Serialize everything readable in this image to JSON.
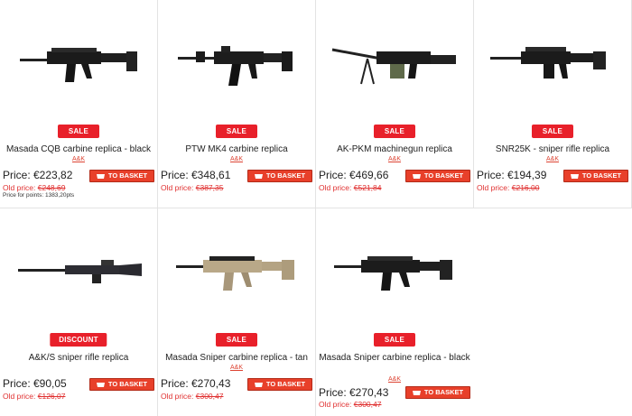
{
  "products": [
    {
      "name": "Masada CQB carbine replica - black",
      "brand": "A&K",
      "badge": "SALE",
      "price": "Price: €223,82",
      "old_label": "Old price: ",
      "old_value": "€248,69",
      "points": "Price for points: 1383,20pts",
      "basket": "TO BASKET"
    },
    {
      "name": "PTW MK4 carbine replica",
      "brand": "A&K",
      "badge": "SALE",
      "price": "Price: €348,61",
      "old_label": "Old price: ",
      "old_value": "€387,35",
      "basket": "TO BASKET"
    },
    {
      "name": "AK-PKM machinegun replica",
      "brand": "A&K",
      "badge": "SALE",
      "price": "Price: €469,66",
      "old_label": "Old price: ",
      "old_value": "€521,84",
      "basket": "TO BASKET"
    },
    {
      "name": "SNR25K - sniper rifle replica",
      "brand": "A&K",
      "badge": "SALE",
      "price": "Price: €194,39",
      "old_label": "Old price: ",
      "old_value": "€216,00",
      "basket": "TO BASKET"
    },
    {
      "name": "A&K/S sniper rifle replica",
      "brand": "",
      "badge": "DISCOUNT",
      "price": "Price: €90,05",
      "old_label": "Old price: ",
      "old_value": "€126,07",
      "basket": "TO BASKET"
    },
    {
      "name": "Masada Sniper carbine replica - tan",
      "brand": "A&K",
      "badge": "SALE",
      "price": "Price: €270,43",
      "old_label": "Old price: ",
      "old_value": "€300,47",
      "basket": "TO BASKET"
    },
    {
      "name": "Masada Sniper carbine replica - black",
      "brand": "A&K",
      "badge": "SALE",
      "price": "Price: €270,43",
      "old_label": "Old price: ",
      "old_value": "€300,47",
      "basket": "TO BASKET"
    }
  ],
  "icons": {
    "basket": "basket-icon"
  },
  "colors": {
    "badge": "#e8202a",
    "basket": "#e8402a",
    "old_price": "#e03030",
    "divider": "#e3e3e3"
  }
}
